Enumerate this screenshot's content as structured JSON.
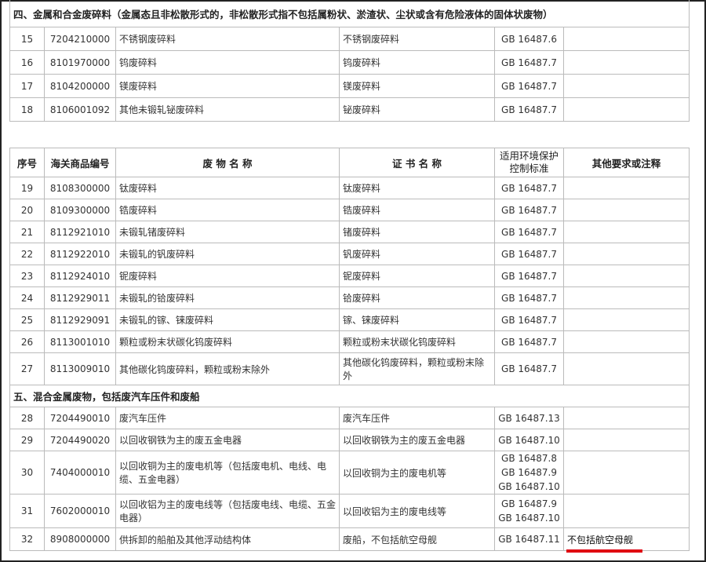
{
  "table_top": {
    "section_heading": "四、金属和合金废碎料（金属态且非松散形式的，非松散形式指不包括属粉状、淤渣状、尘状或含有危险液体的固体状废物）",
    "rows": [
      {
        "no": "15",
        "code": "7204210000",
        "waste": "不锈钢废碎料",
        "cert": "不锈钢废碎料",
        "std": [
          "GB 16487.6"
        ],
        "note": ""
      },
      {
        "no": "16",
        "code": "8101970000",
        "waste": "钨废碎料",
        "cert": "钨废碎料",
        "std": [
          "GB 16487.7"
        ],
        "note": ""
      },
      {
        "no": "17",
        "code": "8104200000",
        "waste": "镁废碎料",
        "cert": "镁废碎料",
        "std": [
          "GB 16487.7"
        ],
        "note": ""
      },
      {
        "no": "18",
        "code": "8106001092",
        "waste": "其他未锻轧铋废碎料",
        "cert": "铋废碎料",
        "std": [
          "GB 16487.7"
        ],
        "note": ""
      }
    ]
  },
  "table_main": {
    "headers": [
      "序号",
      "海关商品编号",
      "废 物 名 称",
      "证 书 名 称",
      "适用环境保护控制标准",
      "其他要求或注释"
    ],
    "rows_a": [
      {
        "no": "19",
        "code": "8108300000",
        "waste": "钛废碎料",
        "cert": "钛废碎料",
        "std": [
          "GB 16487.7"
        ],
        "note": ""
      },
      {
        "no": "20",
        "code": "8109300000",
        "waste": "锆废碎料",
        "cert": "锆废碎料",
        "std": [
          "GB 16487.7"
        ],
        "note": ""
      },
      {
        "no": "21",
        "code": "8112921010",
        "waste": "未锻轧锗废碎料",
        "cert": "锗废碎料",
        "std": [
          "GB 16487.7"
        ],
        "note": ""
      },
      {
        "no": "22",
        "code": "8112922010",
        "waste": "未锻轧的钒废碎料",
        "cert": "钒废碎料",
        "std": [
          "GB 16487.7"
        ],
        "note": ""
      },
      {
        "no": "23",
        "code": "8112924010",
        "waste": "铌废碎料",
        "cert": "铌废碎料",
        "std": [
          "GB 16487.7"
        ],
        "note": ""
      },
      {
        "no": "24",
        "code": "8112929011",
        "waste": "未锻轧的铪废碎料",
        "cert": "铪废碎料",
        "std": [
          "GB 16487.7"
        ],
        "note": ""
      },
      {
        "no": "25",
        "code": "8112929091",
        "waste": "未锻轧的镓、铼废碎料",
        "cert": "镓、铼废碎料",
        "std": [
          "GB 16487.7"
        ],
        "note": ""
      },
      {
        "no": "26",
        "code": "8113001010",
        "waste": "颗粒或粉末状碳化钨废碎料",
        "cert": "颗粒或粉末状碳化钨废碎料",
        "std": [
          "GB 16487.7"
        ],
        "note": ""
      },
      {
        "no": "27",
        "code": "8113009010",
        "waste": "其他碳化钨废碎料，颗粒或粉末除外",
        "cert": "其他碳化钨废碎料，颗粒或粉末除外",
        "std": [
          "GB 16487.7"
        ],
        "note": ""
      }
    ],
    "section_heading": "五、混合金属废物，包括废汽车压件和废船",
    "rows_b": [
      {
        "no": "28",
        "code": "7204490010",
        "waste": "废汽车压件",
        "cert": "废汽车压件",
        "std": [
          "GB 16487.13"
        ],
        "note": ""
      },
      {
        "no": "29",
        "code": "7204490020",
        "waste": "以回收钢铁为主的废五金电器",
        "cert": "以回收钢铁为主的废五金电器",
        "std": [
          "GB 16487.10"
        ],
        "note": ""
      },
      {
        "no": "30",
        "code": "7404000010",
        "waste": "以回收铜为主的废电机等（包括废电机、电线、电缆、五金电器）",
        "cert": "以回收铜为主的废电机等",
        "std": [
          "GB 16487.8",
          "GB 16487.9",
          "GB 16487.10"
        ],
        "note": ""
      },
      {
        "no": "31",
        "code": "7602000010",
        "waste": "以回收铝为主的废电线等（包括废电线、电缆、五金电器）",
        "cert": "以回收铝为主的废电线等",
        "std": [
          "GB 16487.9",
          "GB 16487.10"
        ],
        "note": ""
      },
      {
        "no": "32",
        "code": "8908000000",
        "waste": "供拆卸的船舶及其他浮动结构体",
        "cert": "废船，不包括航空母舰",
        "std": [
          "GB 16487.11"
        ],
        "note": "不包括航空母舰"
      }
    ]
  },
  "highlight_color": "#e00010"
}
